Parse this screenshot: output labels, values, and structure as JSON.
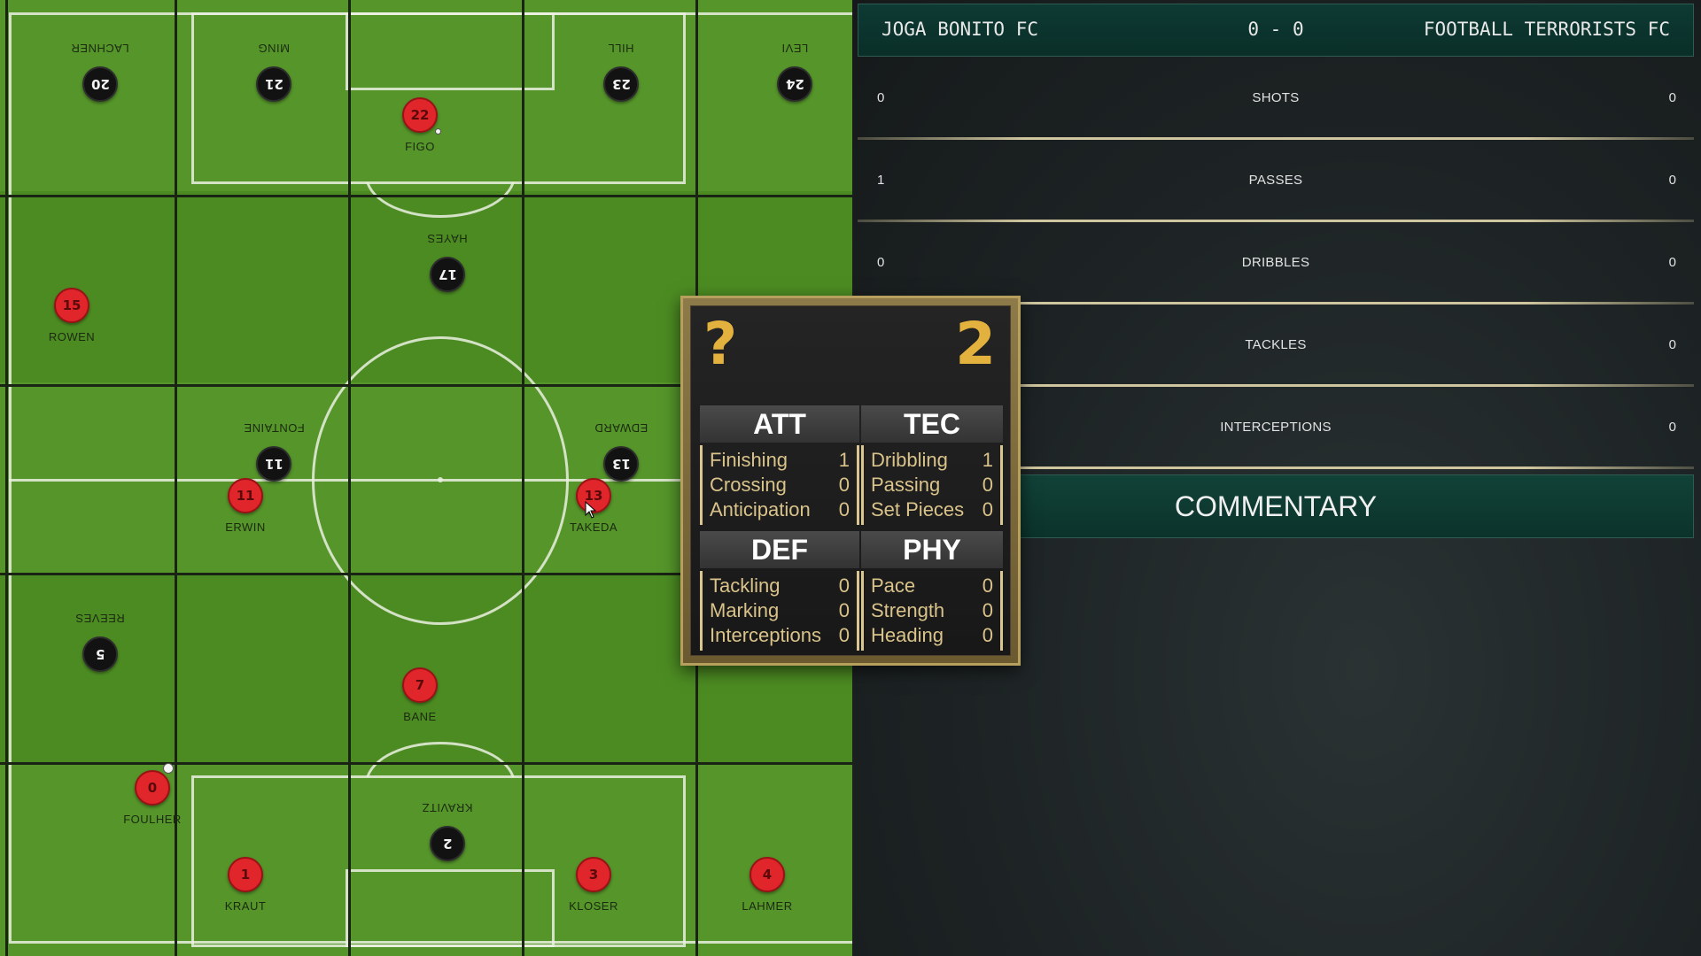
{
  "pitch": {
    "home_players": [
      {
        "number": "22",
        "name": "FIGO"
      },
      {
        "number": "15",
        "name": "ROWEN"
      },
      {
        "number": "11",
        "name": "ERWIN"
      },
      {
        "number": "13",
        "name": "TAKEDA"
      },
      {
        "number": "7",
        "name": "BANE"
      },
      {
        "number": "0",
        "name": "FOULHER"
      },
      {
        "number": "1",
        "name": "KRAUT"
      },
      {
        "number": "3",
        "name": "KLOSER"
      },
      {
        "number": "4",
        "name": "LAHMER"
      }
    ],
    "away_players": [
      {
        "number": "20",
        "name": "LACHNER"
      },
      {
        "number": "21",
        "name": "MING"
      },
      {
        "number": "23",
        "name": "HILL"
      },
      {
        "number": "24",
        "name": "LEVI"
      },
      {
        "number": "17",
        "name": "HAYES"
      },
      {
        "number": "11",
        "name": "FONTAINE"
      },
      {
        "number": "13",
        "name": "EDWARD"
      },
      {
        "number": "5",
        "name": "REEVES"
      },
      {
        "number": "2",
        "name": "KRAVITZ"
      }
    ],
    "colors": {
      "home": "#e0252b",
      "away": "#121212",
      "grass": "#4f8f22"
    }
  },
  "scoreboard": {
    "home_team": "JOGA BONITO FC",
    "score": "0 - 0",
    "away_team": "FOOTBALL TERRORISTS FC"
  },
  "stats": [
    {
      "label": "SHOTS",
      "home": "0",
      "away": "0"
    },
    {
      "label": "PASSES",
      "home": "1",
      "away": "0"
    },
    {
      "label": "DRIBBLES",
      "home": "0",
      "away": "0"
    },
    {
      "label": "TACKLES",
      "home": "",
      "away": "0"
    },
    {
      "label": "INTERCEPTIONS",
      "home": "",
      "away": "0"
    }
  ],
  "commentary": {
    "label": "COMMENTARY"
  },
  "player_card": {
    "position": "?",
    "rating": "2",
    "categories": [
      {
        "title": "ATT",
        "attributes": [
          {
            "name": "Finishing",
            "value": "1"
          },
          {
            "name": "Crossing",
            "value": "0"
          },
          {
            "name": "Anticipation",
            "value": "0"
          }
        ]
      },
      {
        "title": "TEC",
        "attributes": [
          {
            "name": "Dribbling",
            "value": "1"
          },
          {
            "name": "Passing",
            "value": "0"
          },
          {
            "name": "Set Pieces",
            "value": "0"
          }
        ]
      },
      {
        "title": "DEF",
        "attributes": [
          {
            "name": "Tackling",
            "value": "0"
          },
          {
            "name": "Marking",
            "value": "0"
          },
          {
            "name": "Interceptions",
            "value": "0"
          }
        ]
      },
      {
        "title": "PHY",
        "attributes": [
          {
            "name": "Pace",
            "value": "0"
          },
          {
            "name": "Strength",
            "value": "0"
          },
          {
            "name": "Heading",
            "value": "0"
          }
        ]
      }
    ],
    "accent_color": "#e3b23e"
  }
}
